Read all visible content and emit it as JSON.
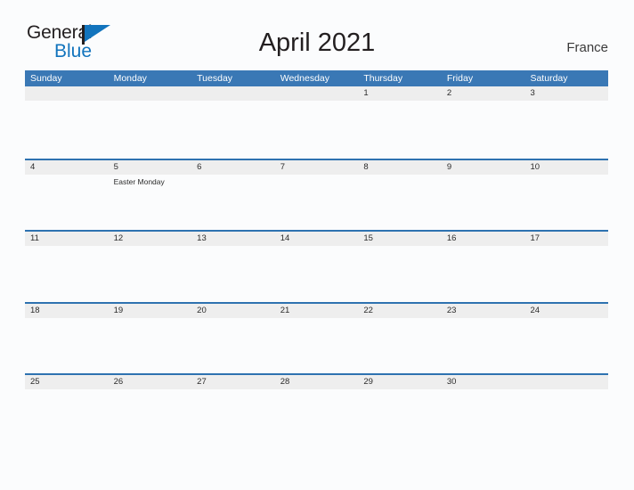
{
  "brand": {
    "name_part1": "General",
    "name_part2": "Blue",
    "flag_icon": "flag-triangle-icon",
    "accent_color": "#1274bd"
  },
  "header": {
    "title": "April 2021",
    "country": "France"
  },
  "calendar": {
    "header_bg_color": "#3a78b5",
    "row_divider_color": "#2e72b0",
    "date_band_color": "#eeeeee",
    "weekdays": [
      "Sunday",
      "Monday",
      "Tuesday",
      "Wednesday",
      "Thursday",
      "Friday",
      "Saturday"
    ],
    "weeks": [
      [
        {
          "date": "",
          "events": []
        },
        {
          "date": "",
          "events": []
        },
        {
          "date": "",
          "events": []
        },
        {
          "date": "",
          "events": []
        },
        {
          "date": "1",
          "events": []
        },
        {
          "date": "2",
          "events": []
        },
        {
          "date": "3",
          "events": []
        }
      ],
      [
        {
          "date": "4",
          "events": []
        },
        {
          "date": "5",
          "events": [
            "Easter Monday"
          ]
        },
        {
          "date": "6",
          "events": []
        },
        {
          "date": "7",
          "events": []
        },
        {
          "date": "8",
          "events": []
        },
        {
          "date": "9",
          "events": []
        },
        {
          "date": "10",
          "events": []
        }
      ],
      [
        {
          "date": "11",
          "events": []
        },
        {
          "date": "12",
          "events": []
        },
        {
          "date": "13",
          "events": []
        },
        {
          "date": "14",
          "events": []
        },
        {
          "date": "15",
          "events": []
        },
        {
          "date": "16",
          "events": []
        },
        {
          "date": "17",
          "events": []
        }
      ],
      [
        {
          "date": "18",
          "events": []
        },
        {
          "date": "19",
          "events": []
        },
        {
          "date": "20",
          "events": []
        },
        {
          "date": "21",
          "events": []
        },
        {
          "date": "22",
          "events": []
        },
        {
          "date": "23",
          "events": []
        },
        {
          "date": "24",
          "events": []
        }
      ],
      [
        {
          "date": "25",
          "events": []
        },
        {
          "date": "26",
          "events": []
        },
        {
          "date": "27",
          "events": []
        },
        {
          "date": "28",
          "events": []
        },
        {
          "date": "29",
          "events": []
        },
        {
          "date": "30",
          "events": []
        },
        {
          "date": "",
          "events": []
        }
      ]
    ]
  }
}
